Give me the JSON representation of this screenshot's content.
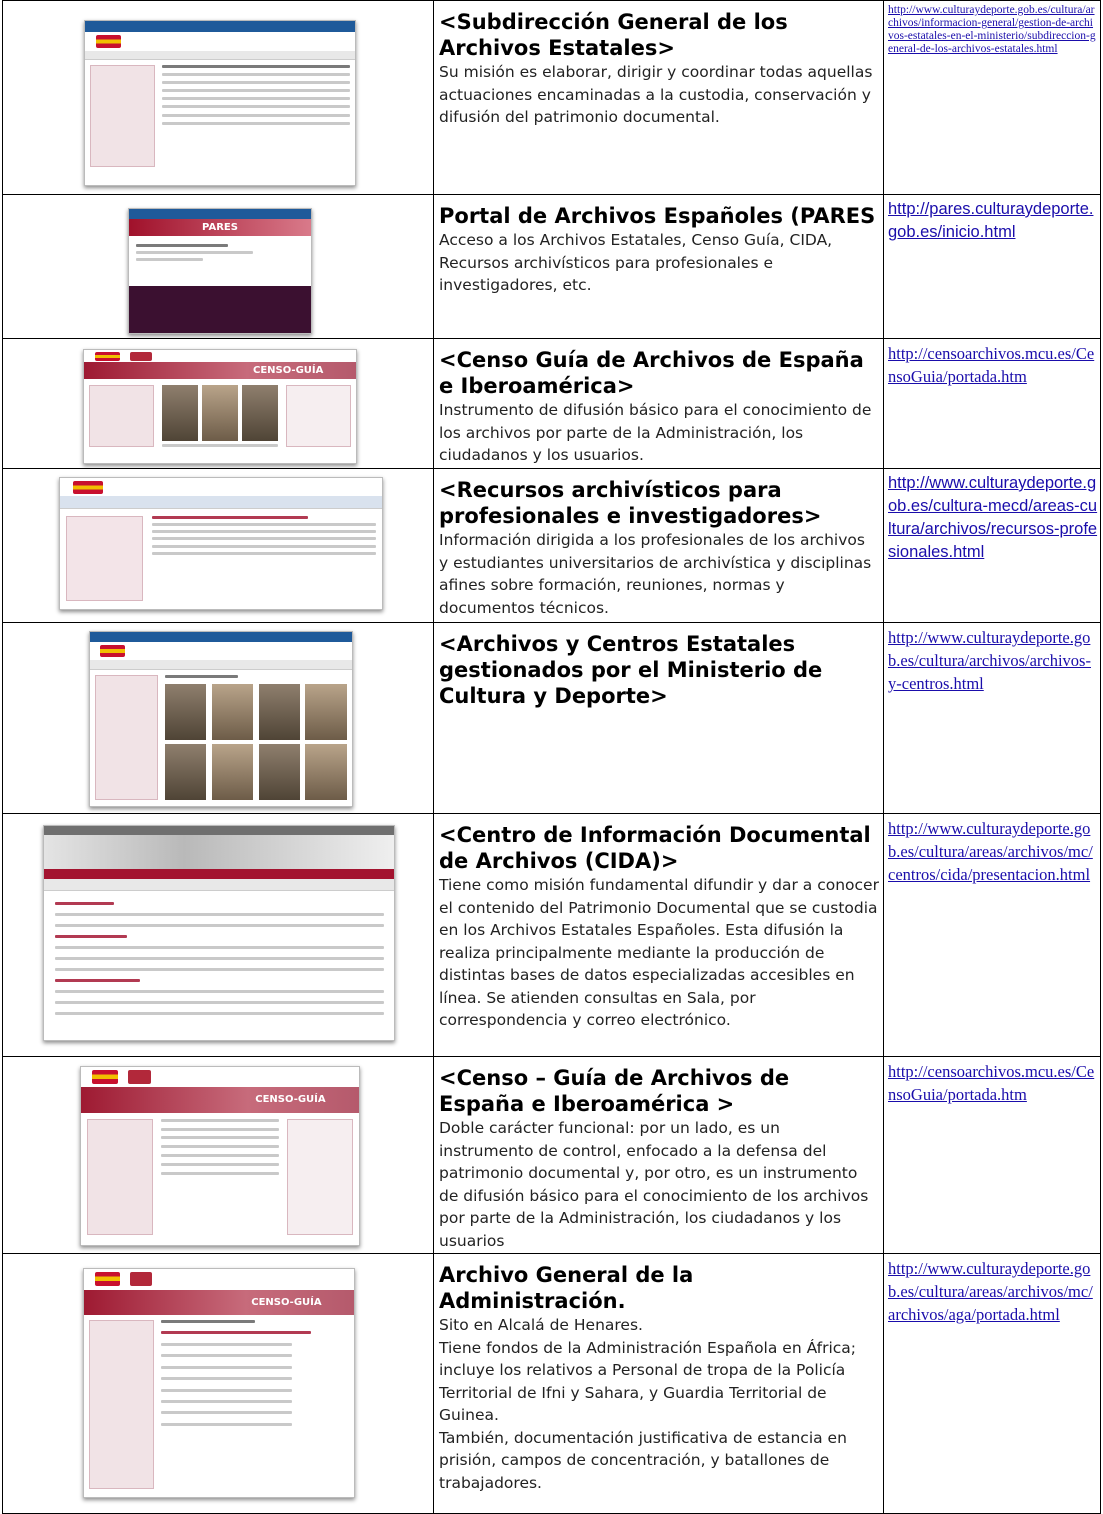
{
  "rows": [
    {
      "title": "<Subdirección General de los Archivos Estatales>",
      "body": "Su misión es elaborar, dirigir y coordinar todas aquellas actuaciones encaminadas a la custodia, conservación y difusión del patrimonio documental.",
      "url": "http://www.culturaydeporte.gob.es/cultura/archivos/informacion-general/gestion-de-archivos-estatales-en-el-ministerio/subdireccion-general-de-los-archivos-estatales.html"
    },
    {
      "title": "Portal de Archivos Españoles (PARES",
      "body": "Acceso a los Archivos Estatales, Censo Guía, CIDA, Recursos archivísticos para profesionales e investigadores, etc.",
      "url": "http://pares.culturaydeporte.gob.es/inicio.html",
      "thumb_text": "PARES"
    },
    {
      "title": "<Censo Guía de Archivos de España e Iberoamérica>",
      "body": "Instrumento de difusión básico para el conocimiento de los archivos por parte de la Administración, los ciudadanos y los usuarios.",
      "url": "http://censoarchivos.mcu.es/CensoGuia/portada.htm",
      "thumb_text": "CENSO-GUÍA"
    },
    {
      "title": "<Recursos archivísticos para profesionales e investigadores>",
      "body": "Información dirigida a los profesionales de los archivos y estudiantes universitarios de archivística y disciplinas afines sobre formación, reuniones, normas y documentos técnicos.",
      "url": "http://www.culturaydeporte.gob.es/cultura-mecd/areas-cultura/archivos/recursos-profesionales.html"
    },
    {
      "title": "<Archivos y Centros Estatales gestionados por el Ministerio de Cultura y Deporte>",
      "body": "",
      "url": "http://www.culturaydeporte.gob.es/cultura/archivos/archivos-y-centros.html"
    },
    {
      "title": "<Centro de Información Documental de Archivos (CIDA)>",
      "body": "Tiene como misión fundamental difundir y dar a conocer el contenido del Patrimonio Documental que se custodia en los Archivos Estatales Españoles. Esta difusión la realiza principalmente mediante la producción de distintas bases de datos especializadas accesibles en línea. Se atienden consultas en Sala, por correspondencia y correo electrónico.",
      "url": "http://www.culturaydeporte.gob.es/cultura/areas/archivos/mc/centros/cida/presentacion.html"
    },
    {
      "title": "<Censo – Guía de Archivos de España e Iberoamérica >",
      "body": "Doble carácter funcional: por un lado, es un instrumento de control, enfocado a la defensa del patrimonio documental y, por otro, es un instrumento de difusión básico para el conocimiento de los archivos por parte de la Administración, los ciudadanos y los usuarios",
      "url": "http://censoarchivos.mcu.es/CensoGuia/portada.htm",
      "thumb_text": "CENSO-GUÍA"
    },
    {
      "title": "Archivo General de la Administración.",
      "body_lines": [
        "Sito en Alcalá de Henares.",
        "Tiene fondos de la Administración Española en África; incluye los relativos a Personal de tropa de la Policía Territorial de Ifni y Sahara, y Guardia Territorial de Guinea.",
        "También, documentación justificativa de estancia en prisión, campos de concentración, y batallones de trabajadores."
      ],
      "url": "http://www.culturaydeporte.gob.es/cultura/areas/archivos/mc/archivos/aga/portada.html",
      "thumb_text": "CENSO-GUÍA"
    }
  ]
}
